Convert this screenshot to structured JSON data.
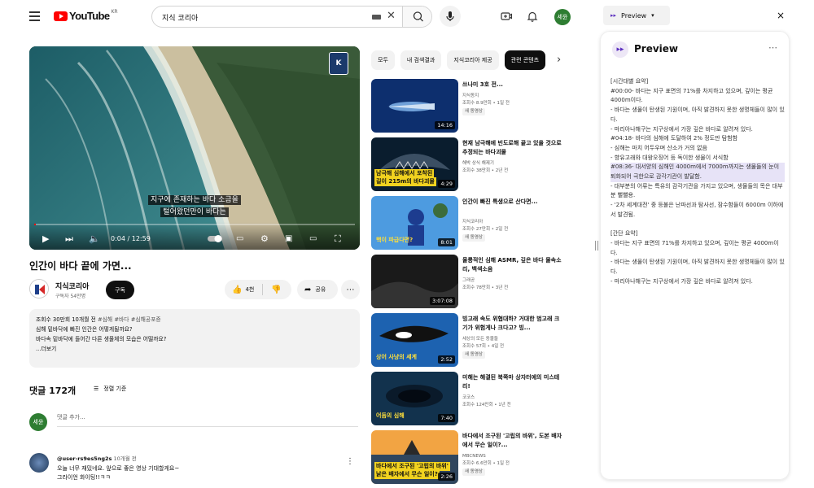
{
  "topbar": {
    "logo_text": "YouTube",
    "logo_region": "KR",
    "search_value": "지식 코리아",
    "avatar_text": "세윤"
  },
  "video": {
    "badge": "K",
    "subtitle_line1": "지구에 존재하는 바다 소금을",
    "subtitle_line2": "털어왔던만이 바다는",
    "time": "0:04 / 12:59",
    "progress": 0.005,
    "title": "인간이 바다 끝에 가면...",
    "channel_name": "지식코리아",
    "channel_subs": "구독자 54만명",
    "subscribe_label": "구독",
    "like_label": "4천",
    "share_label": "공유",
    "description": {
      "line1_meta": "조회수 30만회  10개월 전",
      "line1_tags": "#심해 #바다 #심해공포증",
      "line2": "심해 밑바닥에 빠진 인간은 어떻게될까요?",
      "line3": "바다속 밑바닥에 들어간 다른 생물체의 모습은 어떨까요?",
      "more": "...더보기"
    }
  },
  "comments": {
    "header": "댓글 172개",
    "sort_label": "정렬 기준",
    "my_avatar": "세윤",
    "placeholder": "댓글 추가...",
    "first": {
      "user": "@user-rs9es5ng2s",
      "time": "10개월 전",
      "line1": "오늘 너무 재밌네요. 앞으로 좋은 영상 기대할게요~",
      "line2": "그라이언 화이팅!!ㅋㅋ"
    }
  },
  "chips": [
    "모두",
    "내 검색결과",
    "지식코리아 제공",
    "관련 콘텐츠"
  ],
  "recommendations": [
    {
      "title": "쓰나미 3호 전...",
      "channel": "지식동지",
      "meta": "조회수 8.9만회 • 1일 전",
      "badge": "새 동영상",
      "duration": "14:16",
      "caption": "",
      "theme": "deepblue"
    },
    {
      "title": "현재 남극해에 빈도로해 끝고 있을 것으로 추정되는 바다괴물",
      "channel": "해박 상식 해제기",
      "meta": "조회수 38만회 • 2년 전",
      "badge": "",
      "duration": "4:29",
      "caption": "남극해 심해에서 포착된\n길이 215m의 바다괴물",
      "theme": "shark"
    },
    {
      "title": "인간이 빠진 특생으로 산다면...",
      "channel": "지식코리아",
      "meta": "조회수 27만회 • 2일 전",
      "badge": "새 동영상",
      "duration": "8:01",
      "caption": "핵이 파급다면?",
      "theme": "blue"
    },
    {
      "title": "울릉적인 심해 ASMR, 깊은 바다 물속소리, 백색소음",
      "channel": "그래공",
      "meta": "조회수 78만회 • 3년 전",
      "badge": "",
      "duration": "3:07:08",
      "caption": "",
      "theme": "dark"
    },
    {
      "title": "빙고래 속도 위협대하? 거대한 범고래 크기가 위험게나 크다고? 빙...",
      "channel": "세상의 모든 동물들",
      "meta": "조회수 57회 • 4일 전",
      "badge": "새 동영상",
      "duration": "2:52",
      "caption": "상어 사냥의 세계",
      "theme": "orca"
    },
    {
      "title": "미해는 해결된 북쪽마 상자터에의 미스테리!",
      "channel": "코코스",
      "meta": "조회수 124만회 • 1년 전",
      "badge": "",
      "duration": "7:40",
      "caption": "어둠의 심해",
      "theme": "whirl"
    },
    {
      "title": "바다에서 조구된 '고립의 바위', 도본 배자에서 무슨 일이?...",
      "channel": "MBCNEWS",
      "meta": "조회수 6.6만회 • 1일 전",
      "badge": "새 동영상",
      "duration": "2:26",
      "caption": "바다에서 조구된 '고립의 바위'\n낡은 배자에서 무슨 일이?",
      "theme": "sunset"
    }
  ],
  "panel": {
    "dropdown_label": "Preview",
    "title": "Preview",
    "lines": [
      {
        "text": "[시간대별 요약]",
        "hl": false
      },
      {
        "text": "#00:00- 바다는 지구 표면의 71%를 차지하고 있으며, 깊이는 평균 4000m이다.",
        "hl": false
      },
      {
        "text": "- 바다는 생물이 탄생된 기원이며, 아직 밝견하지 못한 생명체들이 많이 있다.",
        "hl": false
      },
      {
        "text": "- 마리아나해구는 지구상에서 가장 깊은 바다로 알려져 있다.",
        "hl": false
      },
      {
        "text": "#04:18- 바다의 심해에 도달하여 2% 정도만 탐험함",
        "hl": false
      },
      {
        "text": "- 심해는 마치 어두우며 산소가 거의 없음",
        "hl": false
      },
      {
        "text": "- 향유고래와 대왕오징어 등 독이한 생물이 서식함",
        "hl": false
      },
      {
        "text": "#08:36- 대서양의 심해인 4000m에서 7000m까지는 생물들의 눈이 퇴화되어 극한으로 감각기관이 발달함.",
        "hl": true
      },
      {
        "text": "- 대부분의 어류는 특유의 감각기관을 가지고 있으며, 생물들의 목은 대부분 뻘뻘용.",
        "hl": false
      },
      {
        "text": "- '2차 세계대전' 중 등불은 난파선과 탐사선, 잠수함들이 6000m 이하에서 발견됨.",
        "hl": false
      },
      {
        "text": "",
        "hl": false
      },
      {
        "text": "[간단 요약]",
        "hl": false
      },
      {
        "text": "- 바다는 지구 표면의 71%를 차지하고 있으며, 깊이는 평균 4000m이다.",
        "hl": false
      },
      {
        "text": "- 바다는 생물이 탄생된 기원이며, 아직 밝견하지 못한 생명체들이 많이 있다.",
        "hl": false
      },
      {
        "text": "- 마리아나해구는 지구상에서 가장 깊은 바다로 알려져 있다.",
        "hl": false
      }
    ]
  },
  "colors": {
    "accent_red": "#ff0000",
    "avatar_green": "#2e7d32",
    "panel_purple": "#5b2fbf"
  }
}
